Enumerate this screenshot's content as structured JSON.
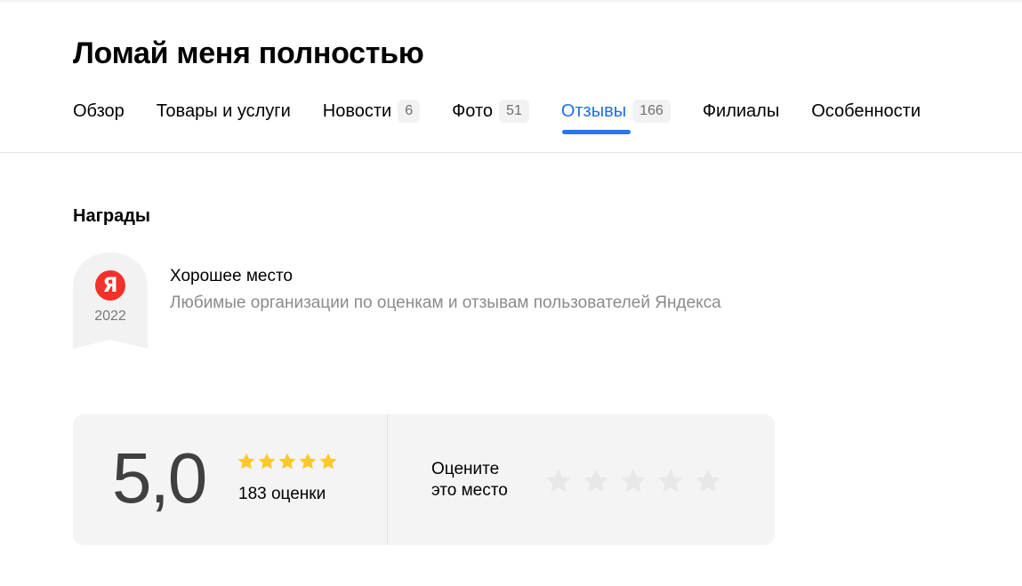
{
  "org": {
    "title": "Ломай меня полностью"
  },
  "tabs": [
    {
      "label": "Обзор",
      "count": ""
    },
    {
      "label": "Товары и услуги",
      "count": ""
    },
    {
      "label": "Новости",
      "count": "6"
    },
    {
      "label": "Фото",
      "count": "51"
    },
    {
      "label": "Отзывы",
      "count": "166"
    },
    {
      "label": "Филиалы",
      "count": ""
    },
    {
      "label": "Особенности",
      "count": ""
    }
  ],
  "active_tab": "Отзывы",
  "awards": {
    "section_title": "Награды",
    "items": [
      {
        "badge_letter": "Я",
        "year": "2022",
        "name": "Хорошее место",
        "description": "Любимые организации по оценкам и отзывам пользователей Яндекса"
      }
    ]
  },
  "rating": {
    "score": "5,0",
    "stars_filled": 5,
    "stars_total": 5,
    "count_label": "183 оценки",
    "rate_prompt_line1": "Оцените",
    "rate_prompt_line2": "это место",
    "rate_stars_total": 5
  },
  "colors": {
    "accent": "#2a76eb",
    "star_filled": "#fcc82a",
    "star_empty": "#e8e8e8",
    "yandex_red": "#f2322a"
  },
  "icons": {
    "star": "star-icon",
    "badge": "yandex-logo-icon"
  }
}
